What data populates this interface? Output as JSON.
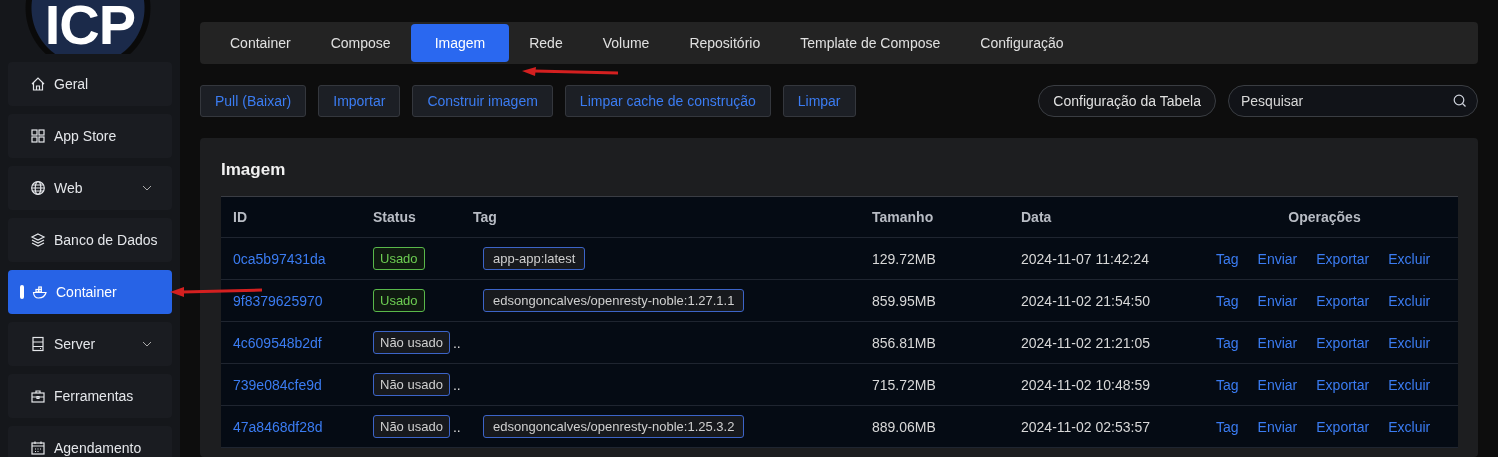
{
  "logo": "ICP",
  "sidebar": {
    "items": [
      {
        "label": "Geral",
        "expandable": false,
        "selected": false
      },
      {
        "label": "App Store",
        "expandable": false,
        "selected": false
      },
      {
        "label": "Web",
        "expandable": true,
        "selected": false
      },
      {
        "label": "Banco de Dados",
        "expandable": false,
        "selected": false
      },
      {
        "label": "Container",
        "expandable": false,
        "selected": true
      },
      {
        "label": "Server",
        "expandable": true,
        "selected": false
      },
      {
        "label": "Ferramentas",
        "expandable": false,
        "selected": false
      },
      {
        "label": "Agendamento",
        "expandable": false,
        "selected": false
      }
    ]
  },
  "tabs": [
    {
      "label": "Container",
      "selected": false
    },
    {
      "label": "Compose",
      "selected": false
    },
    {
      "label": "Imagem",
      "selected": true
    },
    {
      "label": "Rede",
      "selected": false
    },
    {
      "label": "Volume",
      "selected": false
    },
    {
      "label": "Repositório",
      "selected": false
    },
    {
      "label": "Template de Compose",
      "selected": false
    },
    {
      "label": "Configuração",
      "selected": false
    }
  ],
  "toolbar": {
    "buttons": [
      "Pull (Baixar)",
      "Importar",
      "Construir imagem",
      "Limpar cache de construção",
      "Limpar"
    ],
    "table_settings": "Configuração da Tabela",
    "search": {
      "placeholder": "Pesquisar"
    }
  },
  "card": {
    "title": "Imagem",
    "table": {
      "columns": [
        "ID",
        "Status",
        "Tag",
        "Tamanho",
        "Data",
        "Operações"
      ],
      "rows": [
        {
          "id": "0ca5b97431da",
          "status": "Usado",
          "used": true,
          "tag": "app-app:latest",
          "size": "129.72MB",
          "date": "2024-11-07 11:42:24",
          "operations": [
            "Tag",
            "Enviar",
            "Exportar",
            "Excluir"
          ]
        },
        {
          "id": "9f8379625970",
          "status": "Usado",
          "used": true,
          "tag": "edsongoncalves/openresty-noble:1.27.1.1",
          "size": "859.95MB",
          "date": "2024-11-02 21:54:50",
          "operations": [
            "Tag",
            "Enviar",
            "Exportar",
            "Excluir"
          ]
        },
        {
          "id": "4c609548b2df",
          "status": "Não usado",
          "used": false,
          "more": "..",
          "size": "856.81MB",
          "date": "2024-11-02 21:21:05",
          "operations": [
            "Tag",
            "Enviar",
            "Exportar",
            "Excluir"
          ]
        },
        {
          "id": "739e084cfe9d",
          "status": "Não usado",
          "used": false,
          "more": "..",
          "size": "715.72MB",
          "date": "2024-11-02 10:48:59",
          "operations": [
            "Tag",
            "Enviar",
            "Exportar",
            "Excluir"
          ]
        },
        {
          "id": "47a8468df28d",
          "status": "Não usado",
          "used": false,
          "more": "..",
          "tag": "edsongoncalves/openresty-noble:1.25.3.2",
          "size": "889.06MB",
          "date": "2024-11-02 02:53:57",
          "operations": [
            "Tag",
            "Enviar",
            "Exportar",
            "Excluir"
          ]
        }
      ]
    }
  }
}
